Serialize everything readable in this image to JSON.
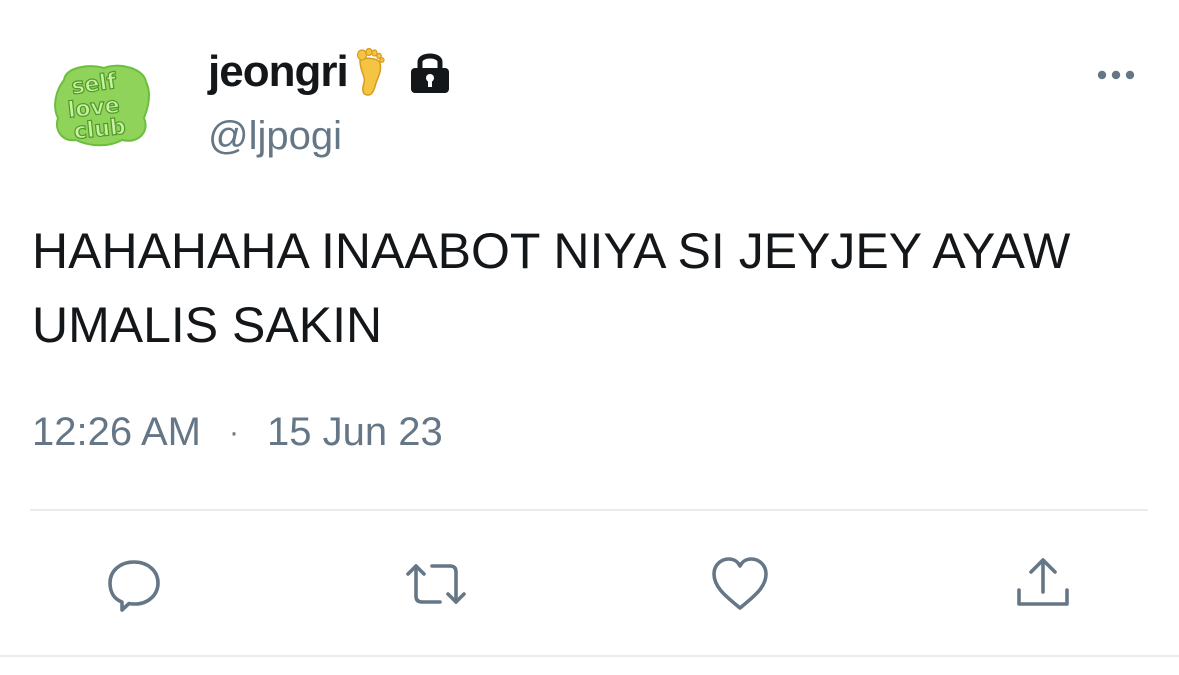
{
  "user": {
    "display_name": "jeongri",
    "handle": "@ljpogi",
    "avatar_icon": "self-love-club-avatar",
    "avatar_text": [
      "self",
      "love",
      "club"
    ],
    "badges": [
      "foot-emoji-icon",
      "lock-icon"
    ]
  },
  "tweet": {
    "text": "HAHAHAHA INAABOT NIYA SI JEYJEY AYAW UMALIS SAKIN",
    "time": "12:26 AM",
    "separator": "·",
    "date": "15 Jun 23"
  },
  "actions": [
    {
      "name": "reply",
      "icon": "speech-bubble-icon"
    },
    {
      "name": "retweet",
      "icon": "retweet-arrows-icon"
    },
    {
      "name": "like",
      "icon": "heart-icon"
    },
    {
      "name": "share",
      "icon": "share-upload-icon"
    }
  ],
  "colors": {
    "text": "#14171a",
    "secondary": "#657786",
    "divider": "#e6ecf0",
    "avatar_green": "#8fd35a",
    "avatar_dark": "#4e9a2a"
  }
}
